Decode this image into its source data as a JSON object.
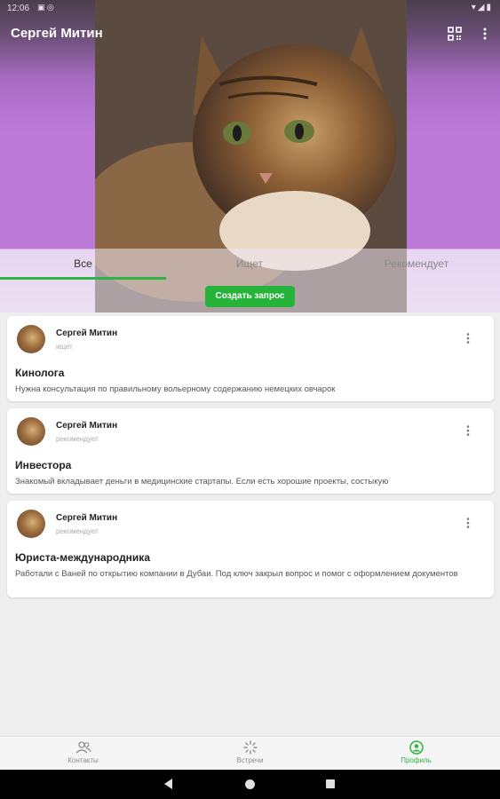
{
  "status_bar": {
    "time": "12:06",
    "left_icons": "▣ ◎",
    "right_icons": "▾◢▮"
  },
  "header": {
    "title": "Сергей Митин",
    "qr_icon": "qr-code-icon",
    "more_icon": "more-vert-icon"
  },
  "tabs": [
    {
      "label": "Все",
      "active": true
    },
    {
      "label": "Ищет",
      "active": false
    },
    {
      "label": "Рекомендует",
      "active": false
    }
  ],
  "create_button": "Создать запрос",
  "cards": [
    {
      "author": "Сергей Митин",
      "role": "ищет",
      "title": "Кинолога",
      "description": "Нужна консультация по правильному вольерному содержанию немецких овчарок"
    },
    {
      "author": "Сергей Митин",
      "role": "рекомендует",
      "title": "Инвестора",
      "description": "Знакомый вкладывает деньги в медицинские стартапы. Если есть хорошие проекты, состыкую"
    },
    {
      "author": "Сергей Митин",
      "role": "рекомендует",
      "title": "Юриста-международника",
      "description": "Работали с Ваней по открытию компании в Дубаи. Под ключ закрыл вопрос и помог с оформлением документов"
    }
  ],
  "bottom_nav": [
    {
      "label": "Контакты",
      "icon": "contacts-icon",
      "active": false
    },
    {
      "label": "Встречи",
      "icon": "meetings-icon",
      "active": false
    },
    {
      "label": "Профиль",
      "icon": "profile-icon",
      "active": true
    }
  ],
  "colors": {
    "accent": "#2fb344",
    "header_purple": "#bd7ad8"
  }
}
